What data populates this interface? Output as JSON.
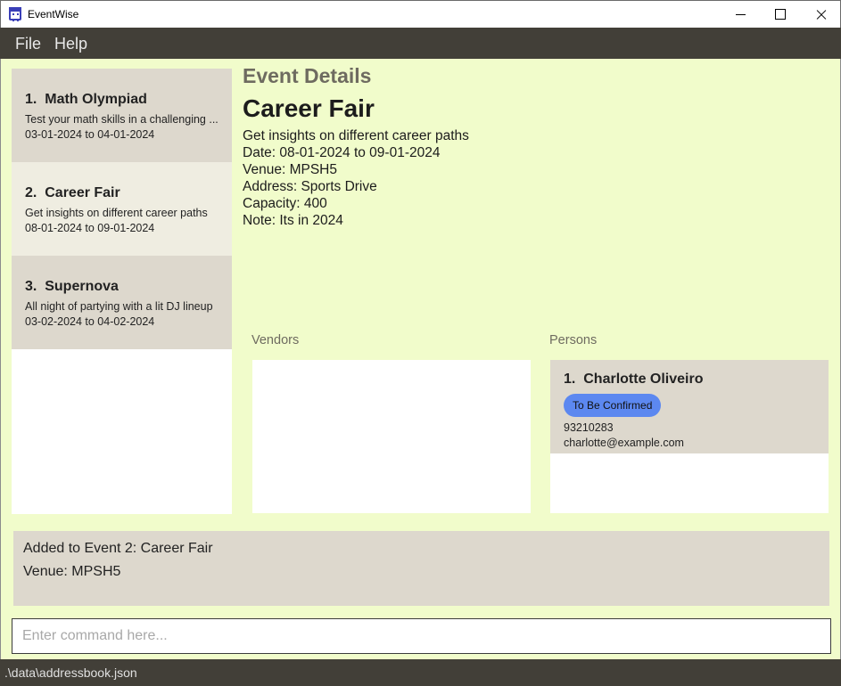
{
  "window": {
    "title": "EventWise",
    "icon": "calendar-icon"
  },
  "menu": {
    "file": "File",
    "help": "Help"
  },
  "events": [
    {
      "index": "1.",
      "name": "Math Olympiad",
      "description": "Test your math skills in a challenging ...",
      "dates": "03-01-2024 to 04-01-2024",
      "selected": false
    },
    {
      "index": "2.",
      "name": "Career Fair",
      "description": "Get insights on different career paths",
      "dates": "08-01-2024 to 09-01-2024",
      "selected": true
    },
    {
      "index": "3.",
      "name": "Supernova",
      "description": "All night of partying with a lit DJ lineup",
      "dates": "03-02-2024 to 04-02-2024",
      "selected": false
    }
  ],
  "details": {
    "heading": "Event Details",
    "name": "Career Fair",
    "description": "Get insights on different career paths",
    "date": "Date: 08-01-2024 to 09-01-2024",
    "venue": "Venue: MPSH5",
    "address": "Address: Sports Drive",
    "capacity": "Capacity: 400",
    "note": "Note: Its in 2024"
  },
  "vendors": {
    "label": "Vendors"
  },
  "persons": {
    "label": "Persons",
    "items": [
      {
        "index": "1.",
        "name": "Charlotte Oliveiro",
        "tag": "To Be Confirmed",
        "phone": "93210283",
        "email": "charlotte@example.com"
      }
    ]
  },
  "result": {
    "line1": "Added to Event 2: Career Fair",
    "line2": "Venue: MPSH5"
  },
  "command": {
    "placeholder": "Enter command here...",
    "value": ""
  },
  "status": {
    "path": ".\\data\\addressbook.json"
  },
  "colors": {
    "menubar": "#423f38",
    "background": "#f1fccb",
    "card": "#ddd8cd",
    "card_selected": "#efede1",
    "tag": "#5c88f0"
  }
}
